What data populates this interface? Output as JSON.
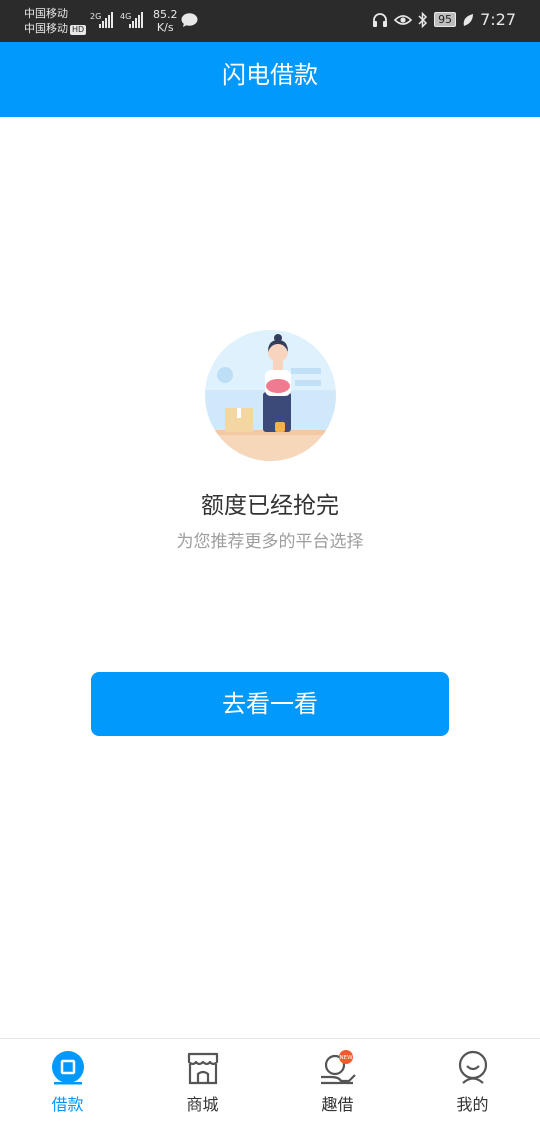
{
  "status_bar": {
    "carrier_1": "中国移动",
    "carrier_2": "中国移动",
    "hd": "HD",
    "sig1": "2G",
    "sig2": "4G",
    "speed_value": "85.2",
    "speed_unit": "K/s",
    "battery": "95",
    "time": "7:27"
  },
  "header": {
    "title": "闪电借款"
  },
  "empty_state": {
    "title": "额度已经抢完",
    "subtitle": "为您推荐更多的平台选择",
    "illustration_icon": "shop-girl-illustration"
  },
  "cta": {
    "label": "去看一看"
  },
  "tab_bar": {
    "active_color": "#0199fc",
    "items": [
      {
        "label": "借款",
        "icon": "loan-icon",
        "active": true
      },
      {
        "label": "商城",
        "icon": "store-icon",
        "active": false
      },
      {
        "label": "趣借",
        "icon": "hand-coin-icon",
        "active": false,
        "badge": "NEW"
      },
      {
        "label": "我的",
        "icon": "profile-icon",
        "active": false
      }
    ]
  },
  "colors": {
    "primary": "#0199fc",
    "status_bar": "#2b2b2b"
  }
}
